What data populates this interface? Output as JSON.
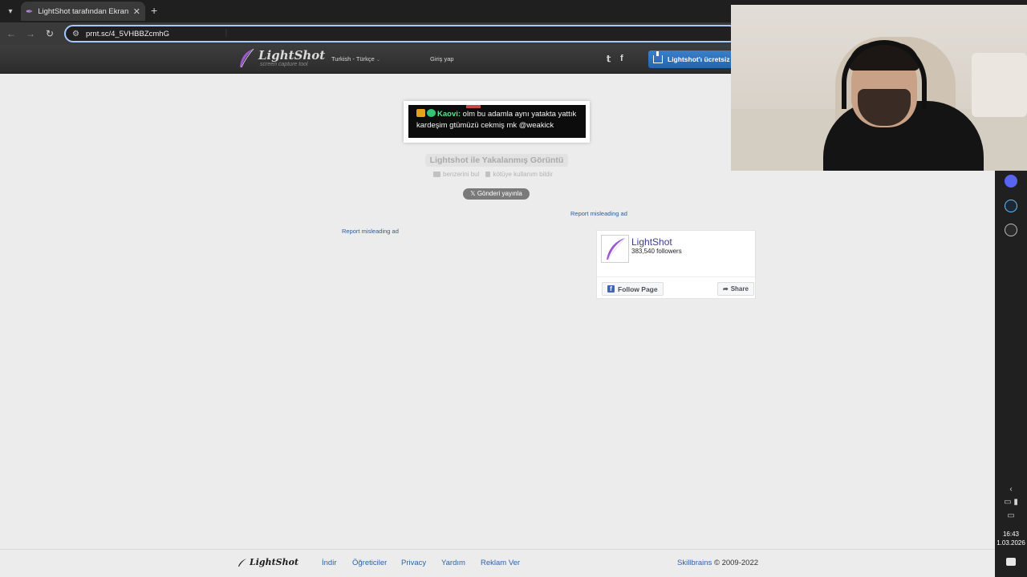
{
  "browser": {
    "tab_title": "LightShot tarafından Ekran Gör",
    "url": "prnt.sc/4_5VHBBZcmhG"
  },
  "header": {
    "logo_name": "LightShot",
    "logo_tagline": "screen capture tool",
    "language": "Turkish - Türkçe",
    "login": "Giriş yap",
    "download_label": "Lightshot'ı ücretsiz i"
  },
  "screenshot": {
    "line1_name": "Kaovi:",
    "line1_text": " olm bu adamla aynı yatakta yattık",
    "line2_text": "kardeşim gtümüzü cekmiş mk @weakick"
  },
  "main": {
    "caption": "Lightshot ile Yakalanmış Görüntü",
    "similar": "benzerini bul",
    "report_abuse": "kötüye kullanım bildir",
    "post_button": "Gönderi yayınla",
    "report_ad_right": "Report misleading ad",
    "report_ad_left": "Report misleading ad"
  },
  "facebook": {
    "page_name": "LightShot",
    "followers": "383,540 followers",
    "follow": "Follow Page",
    "share": "Share"
  },
  "footer": {
    "logo": "LightShot",
    "links": [
      "İndir",
      "Öğreticiler",
      "Privacy",
      "Yardım",
      "Reklam Ver"
    ],
    "company": "Skillbrains",
    "copyright": "© 2009-2022"
  },
  "taskbar": {
    "time": "16:43",
    "date": "1.03.2026"
  },
  "colors": {
    "brand_purple": "#9b59d0",
    "link_blue": "#2f63a7",
    "download_blue": "#2566ad"
  }
}
